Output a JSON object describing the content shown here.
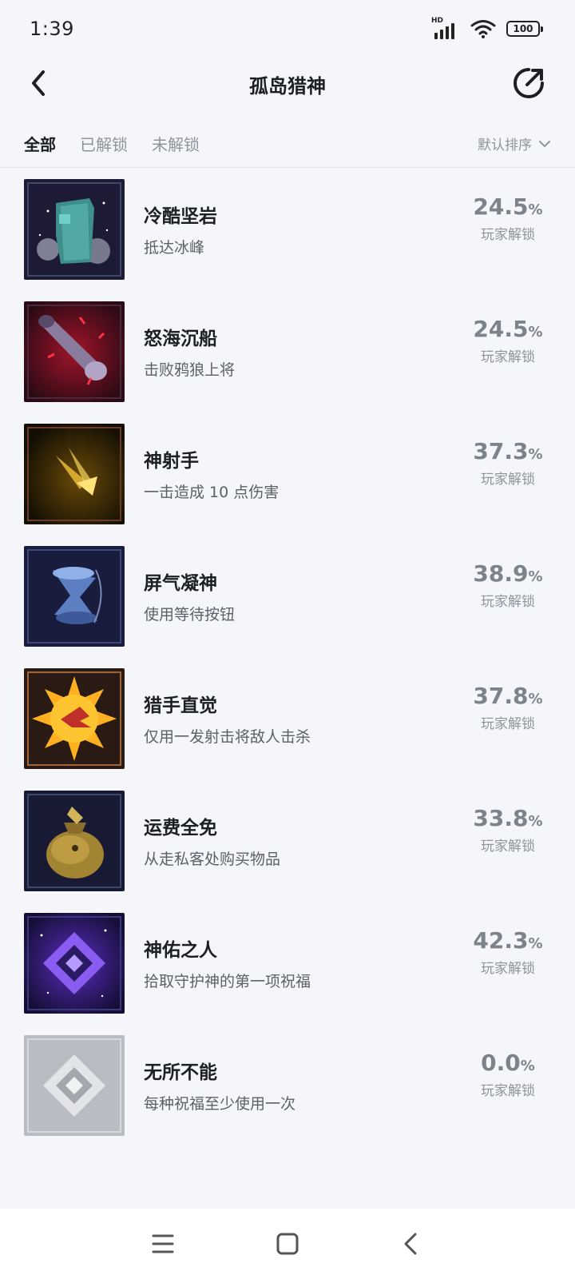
{
  "status": {
    "time": "1:39",
    "hd": "HD",
    "battery": "100"
  },
  "header": {
    "title": "孤岛猎神"
  },
  "tabs": [
    {
      "label": "全部",
      "active": true
    },
    {
      "label": "已解锁",
      "active": false
    },
    {
      "label": "未解锁",
      "active": false
    }
  ],
  "sort": {
    "label": "默认排序"
  },
  "achievements": [
    {
      "title": "冷酷坚岩",
      "desc": "抵达冰峰",
      "percent": "24.5",
      "sub": "玩家解锁",
      "icon": "frozen-rock-icon"
    },
    {
      "title": "怒海沉船",
      "desc": "击败鸦狼上将",
      "percent": "24.5",
      "sub": "玩家解锁",
      "icon": "cannon-icon"
    },
    {
      "title": "神射手",
      "desc": "一击造成 10 点伤害",
      "percent": "37.3",
      "sub": "玩家解锁",
      "icon": "bullet-impact-icon"
    },
    {
      "title": "屏气凝神",
      "desc": "使用等待按钮",
      "percent": "38.9",
      "sub": "玩家解锁",
      "icon": "hourglass-icon"
    },
    {
      "title": "猎手直觉",
      "desc": "仅用一发射击将敌人击杀",
      "percent": "37.8",
      "sub": "玩家解锁",
      "icon": "sun-burst-icon"
    },
    {
      "title": "运费全免",
      "desc": "从走私客处购买物品",
      "percent": "33.8",
      "sub": "玩家解锁",
      "icon": "loot-bag-icon"
    },
    {
      "title": "神佑之人",
      "desc": "拾取守护神的第一项祝福",
      "percent": "42.3",
      "sub": "玩家解锁",
      "icon": "blessing-diamond-icon"
    },
    {
      "title": "无所不能",
      "desc": "每种祝福至少使用一次",
      "percent": "0.0",
      "sub": "玩家解锁",
      "icon": "locked-diamond-icon"
    }
  ],
  "percent_sign": "%",
  "colors": {
    "accent": "#1c1f24",
    "muted": "#8e949c",
    "background": "#f4f6f9"
  }
}
